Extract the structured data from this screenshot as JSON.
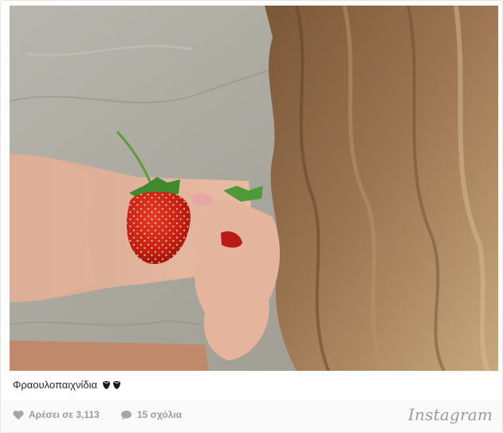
{
  "post": {
    "caption": "Φραουλοπαιχνίδια",
    "caption_emoji": [
      "strawberry-emoji",
      "strawberry-emoji"
    ]
  },
  "footer": {
    "likes_label": "Αρέσει σε 3,113",
    "comments_label": "15 σχόλια",
    "brand": "Instagram"
  },
  "icons": {
    "like": "heart-icon",
    "comment": "comment-bubble-icon"
  },
  "colors": {
    "footer_text": "#9a9a9a",
    "footer_bg": "#fafafa",
    "caption_text": "#262626"
  }
}
